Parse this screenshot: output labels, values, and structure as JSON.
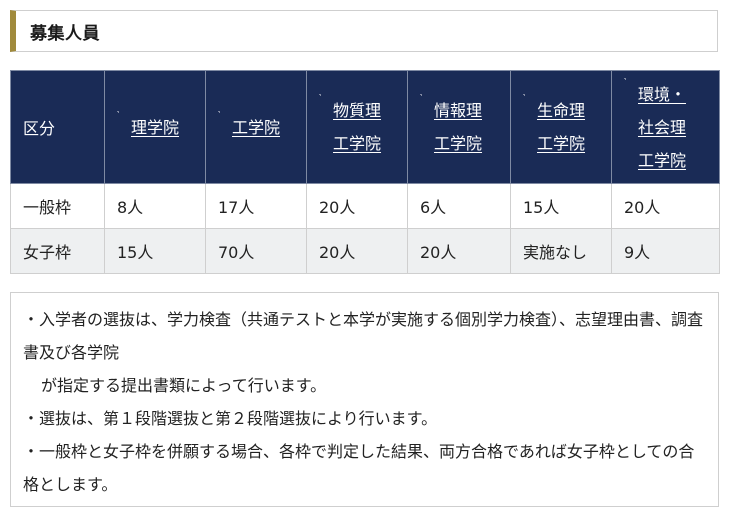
{
  "section_title": "募集人員",
  "table": {
    "header_label": "区分",
    "columns": [
      {
        "lines": [
          "理学院"
        ]
      },
      {
        "lines": [
          "工学院"
        ]
      },
      {
        "lines": [
          "物質理",
          "工学院"
        ]
      },
      {
        "lines": [
          "情報理",
          "工学院"
        ]
      },
      {
        "lines": [
          "生命理",
          "工学院"
        ]
      },
      {
        "lines": [
          "環境・",
          "社会理",
          "工学院"
        ]
      }
    ],
    "rows": [
      {
        "label": "一般枠",
        "values": [
          "8人",
          "17人",
          "20人",
          "6人",
          "15人",
          "20人"
        ]
      },
      {
        "label": "女子枠",
        "values": [
          "15人",
          "70人",
          "20人",
          "20人",
          "実施なし",
          "9人"
        ]
      }
    ]
  },
  "notes": [
    "・入学者の選抜は、学力検査（共通テストと本学が実施する個別学力検査）、志望理由書、調査書及び各学院",
    "が指定する提出書類によって行います。",
    "・選抜は、第１段階選抜と第２段階選抜により行います。",
    "・一般枠と女子枠を併願する場合、各枠で判定した結果、両方合格であれば女子枠としての合格とします。"
  ]
}
